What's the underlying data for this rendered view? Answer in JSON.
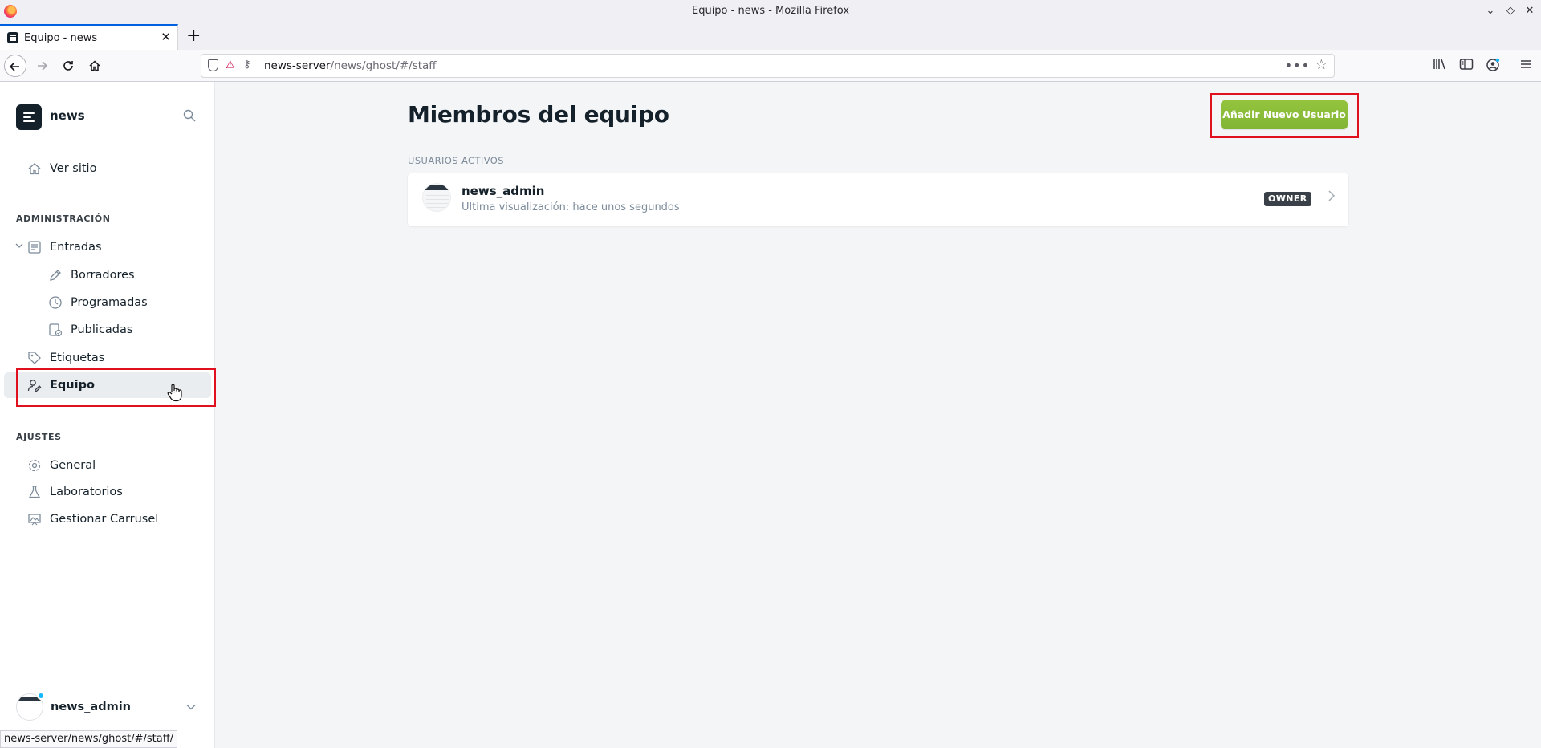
{
  "window": {
    "title": "Equipo - news - Mozilla Firefox"
  },
  "browser": {
    "tab_title": "Equipo - news",
    "url_host": "news-server",
    "url_path": "/news/ghost/#/staff",
    "status_url": "news-server/news/ghost/#/staff/"
  },
  "sidebar": {
    "brand": "news",
    "view_site": "Ver sitio",
    "admin_heading": "ADMINISTRACIÓN",
    "posts": "Entradas",
    "drafts": "Borradores",
    "scheduled": "Programadas",
    "published": "Publicadas",
    "tags": "Etiquetas",
    "staff": "Equipo",
    "settings_heading": "AJUSTES",
    "general": "General",
    "labs": "Laboratorios",
    "carousel": "Gestionar Carrusel",
    "user_name": "news_admin"
  },
  "main": {
    "title": "Miembros del equipo",
    "add_button": "Añadir Nuevo Usuario",
    "section_label": "USUARIOS ACTIVOS",
    "users": [
      {
        "name": "news_admin",
        "last_seen": "Última visualización: hace unos segundos",
        "role": "OWNER"
      }
    ]
  },
  "colors": {
    "accent_green": "#8bbe3c",
    "highlight_red": "#e0101e",
    "sidebar_active": "#eaedf0"
  }
}
